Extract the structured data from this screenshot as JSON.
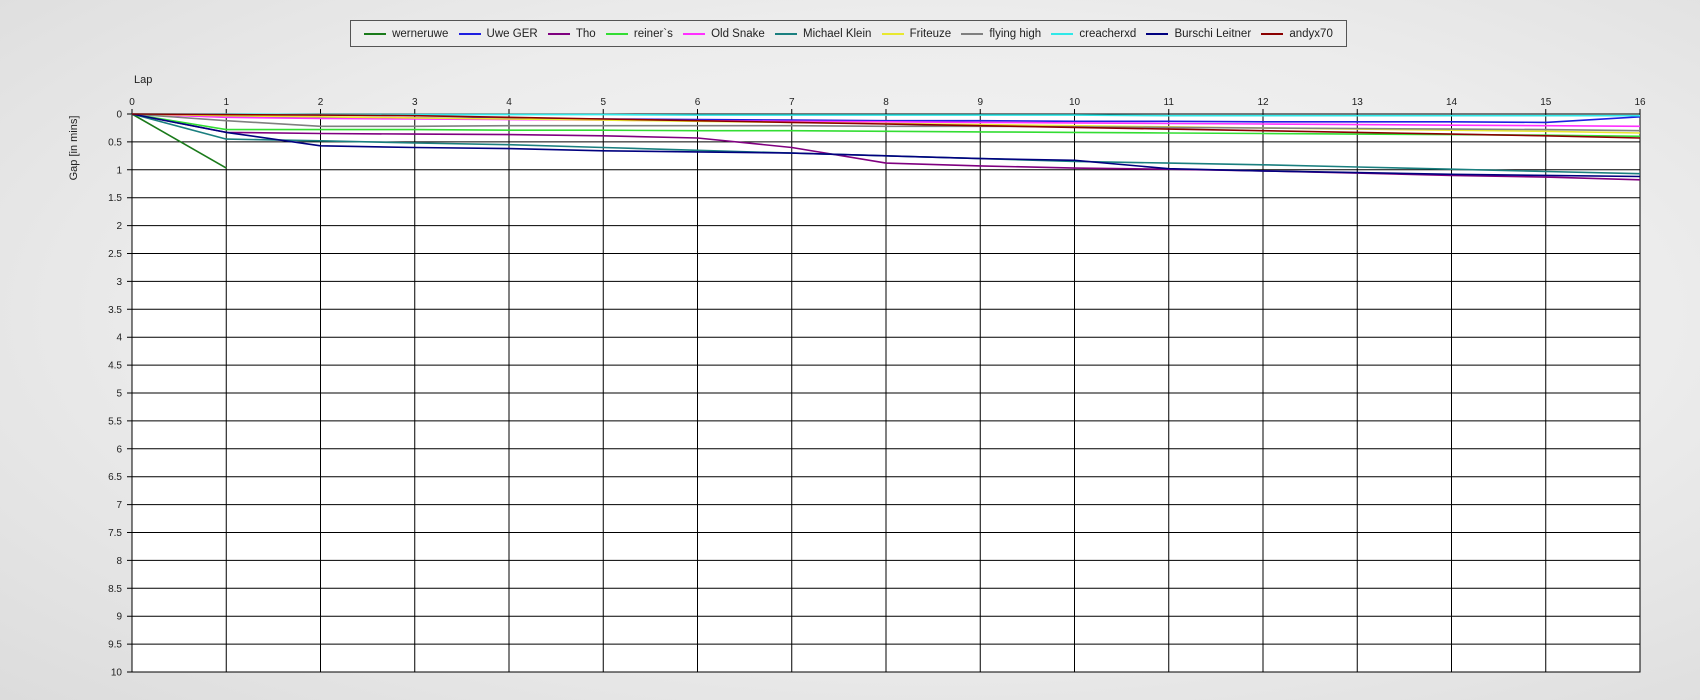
{
  "chart_data": {
    "type": "line",
    "xlabel": "Lap",
    "ylabel": "Gap [in mins]",
    "xlim": [
      0,
      16
    ],
    "ylim": [
      0,
      10
    ],
    "y_inverted": true,
    "grid": true,
    "legend_position": "top-center",
    "x_ticks": [
      "0",
      "1",
      "2",
      "3",
      "4",
      "5",
      "6",
      "7",
      "8",
      "9",
      "10",
      "11",
      "12",
      "13",
      "14",
      "15",
      "16"
    ],
    "y_ticks": [
      "0",
      "0.5",
      "1",
      "1.5",
      "2",
      "2.5",
      "3",
      "3.5",
      "4",
      "4.5",
      "5",
      "5.5",
      "6",
      "6.5",
      "7",
      "7.5",
      "8",
      "8.5",
      "9",
      "9.5",
      "10"
    ],
    "series": [
      {
        "name": "werneruwe",
        "color": "#1a7a1a",
        "x": [
          0,
          1
        ],
        "y": [
          0,
          0.97
        ]
      },
      {
        "name": "Uwe GER",
        "color": "#1f1fe0",
        "x": [
          0,
          1,
          2,
          3,
          4,
          5,
          6,
          7,
          8,
          9,
          10,
          11,
          12,
          13,
          14,
          15,
          16
        ],
        "y": [
          0,
          0.05,
          0.06,
          0.07,
          0.08,
          0.09,
          0.1,
          0.11,
          0.12,
          0.12,
          0.13,
          0.13,
          0.14,
          0.14,
          0.14,
          0.15,
          0.05
        ]
      },
      {
        "name": "Tho",
        "color": "#800080",
        "x": [
          0,
          1,
          2,
          3,
          4,
          5,
          6,
          7,
          8,
          9,
          10,
          11,
          12,
          13,
          14,
          15,
          16
        ],
        "y": [
          0,
          0.33,
          0.35,
          0.36,
          0.37,
          0.39,
          0.43,
          0.6,
          0.88,
          0.93,
          0.97,
          0.99,
          1.02,
          1.06,
          1.1,
          1.13,
          1.18
        ]
      },
      {
        "name": "reiner`s",
        "color": "#33dd33",
        "x": [
          0,
          1,
          2,
          3,
          4,
          5,
          6,
          7,
          8,
          9,
          10,
          11,
          12,
          13,
          14,
          15,
          16
        ],
        "y": [
          0,
          0.28,
          0.28,
          0.28,
          0.29,
          0.29,
          0.3,
          0.3,
          0.31,
          0.32,
          0.33,
          0.34,
          0.35,
          0.36,
          0.37,
          0.38,
          0.4
        ]
      },
      {
        "name": "Old Snake",
        "color": "#ff30ff",
        "x": [
          0,
          1,
          2,
          3,
          4,
          5,
          6,
          7,
          8,
          9,
          10,
          11,
          12,
          13,
          14,
          15,
          16
        ],
        "y": [
          0,
          0.06,
          0.08,
          0.09,
          0.1,
          0.11,
          0.12,
          0.13,
          0.14,
          0.15,
          0.16,
          0.17,
          0.18,
          0.19,
          0.2,
          0.21,
          0.22
        ]
      },
      {
        "name": "Michael Klein",
        "color": "#1a7f7f",
        "x": [
          0,
          1,
          2,
          3,
          4,
          5,
          6,
          7,
          8,
          9,
          10,
          11,
          12,
          13,
          14,
          15,
          16
        ],
        "y": [
          0,
          0.45,
          0.48,
          0.52,
          0.55,
          0.6,
          0.65,
          0.7,
          0.75,
          0.8,
          0.85,
          0.88,
          0.91,
          0.95,
          0.99,
          1.03,
          1.07
        ]
      },
      {
        "name": "Friteuze",
        "color": "#e8e830",
        "x": [
          0,
          1,
          2,
          3,
          4,
          5,
          6,
          7,
          8,
          9,
          10,
          11,
          12,
          13,
          14,
          15,
          16
        ],
        "y": [
          0,
          0.03,
          0.05,
          0.07,
          0.09,
          0.11,
          0.13,
          0.15,
          0.17,
          0.19,
          0.21,
          0.23,
          0.25,
          0.27,
          0.29,
          0.31,
          0.34
        ]
      },
      {
        "name": "flying high",
        "color": "#808080",
        "x": [
          0,
          1,
          2,
          3,
          4,
          5,
          6,
          7,
          8,
          9,
          10,
          11,
          12,
          13,
          14,
          15,
          16
        ],
        "y": [
          0,
          0.12,
          0.22,
          0.22,
          0.21,
          0.21,
          0.21,
          0.21,
          0.22,
          0.22,
          0.23,
          0.24,
          0.25,
          0.26,
          0.27,
          0.28,
          0.3
        ]
      },
      {
        "name": "creacherxd",
        "color": "#30e8e8",
        "x": [
          0,
          1,
          2,
          3,
          4,
          5,
          6,
          7,
          8,
          9,
          10,
          11,
          12,
          13,
          14,
          15,
          16
        ],
        "y": [
          0,
          0.0,
          0.01,
          0.01,
          0.01,
          0.01,
          0.02,
          0.02,
          0.02,
          0.02,
          0.02,
          0.03,
          0.03,
          0.03,
          0.03,
          0.03,
          0.03
        ]
      },
      {
        "name": "Burschi Leitner",
        "color": "#00007f",
        "x": [
          0,
          1,
          2,
          3,
          4,
          5,
          6,
          7,
          8,
          9,
          10,
          11,
          12,
          13,
          14,
          15,
          16
        ],
        "y": [
          0,
          0.33,
          0.57,
          0.6,
          0.62,
          0.66,
          0.68,
          0.7,
          0.75,
          0.8,
          0.83,
          0.98,
          1.02,
          1.05,
          1.08,
          1.1,
          1.12
        ]
      },
      {
        "name": "andyx70",
        "color": "#8b0000",
        "x": [
          0,
          1,
          2,
          3,
          4,
          5,
          6,
          7,
          8,
          9,
          10,
          11,
          12,
          13,
          14,
          15,
          16
        ],
        "y": [
          0,
          0.01,
          0.02,
          0.03,
          0.06,
          0.09,
          0.12,
          0.15,
          0.18,
          0.21,
          0.24,
          0.27,
          0.3,
          0.33,
          0.36,
          0.39,
          0.43
        ]
      }
    ]
  }
}
